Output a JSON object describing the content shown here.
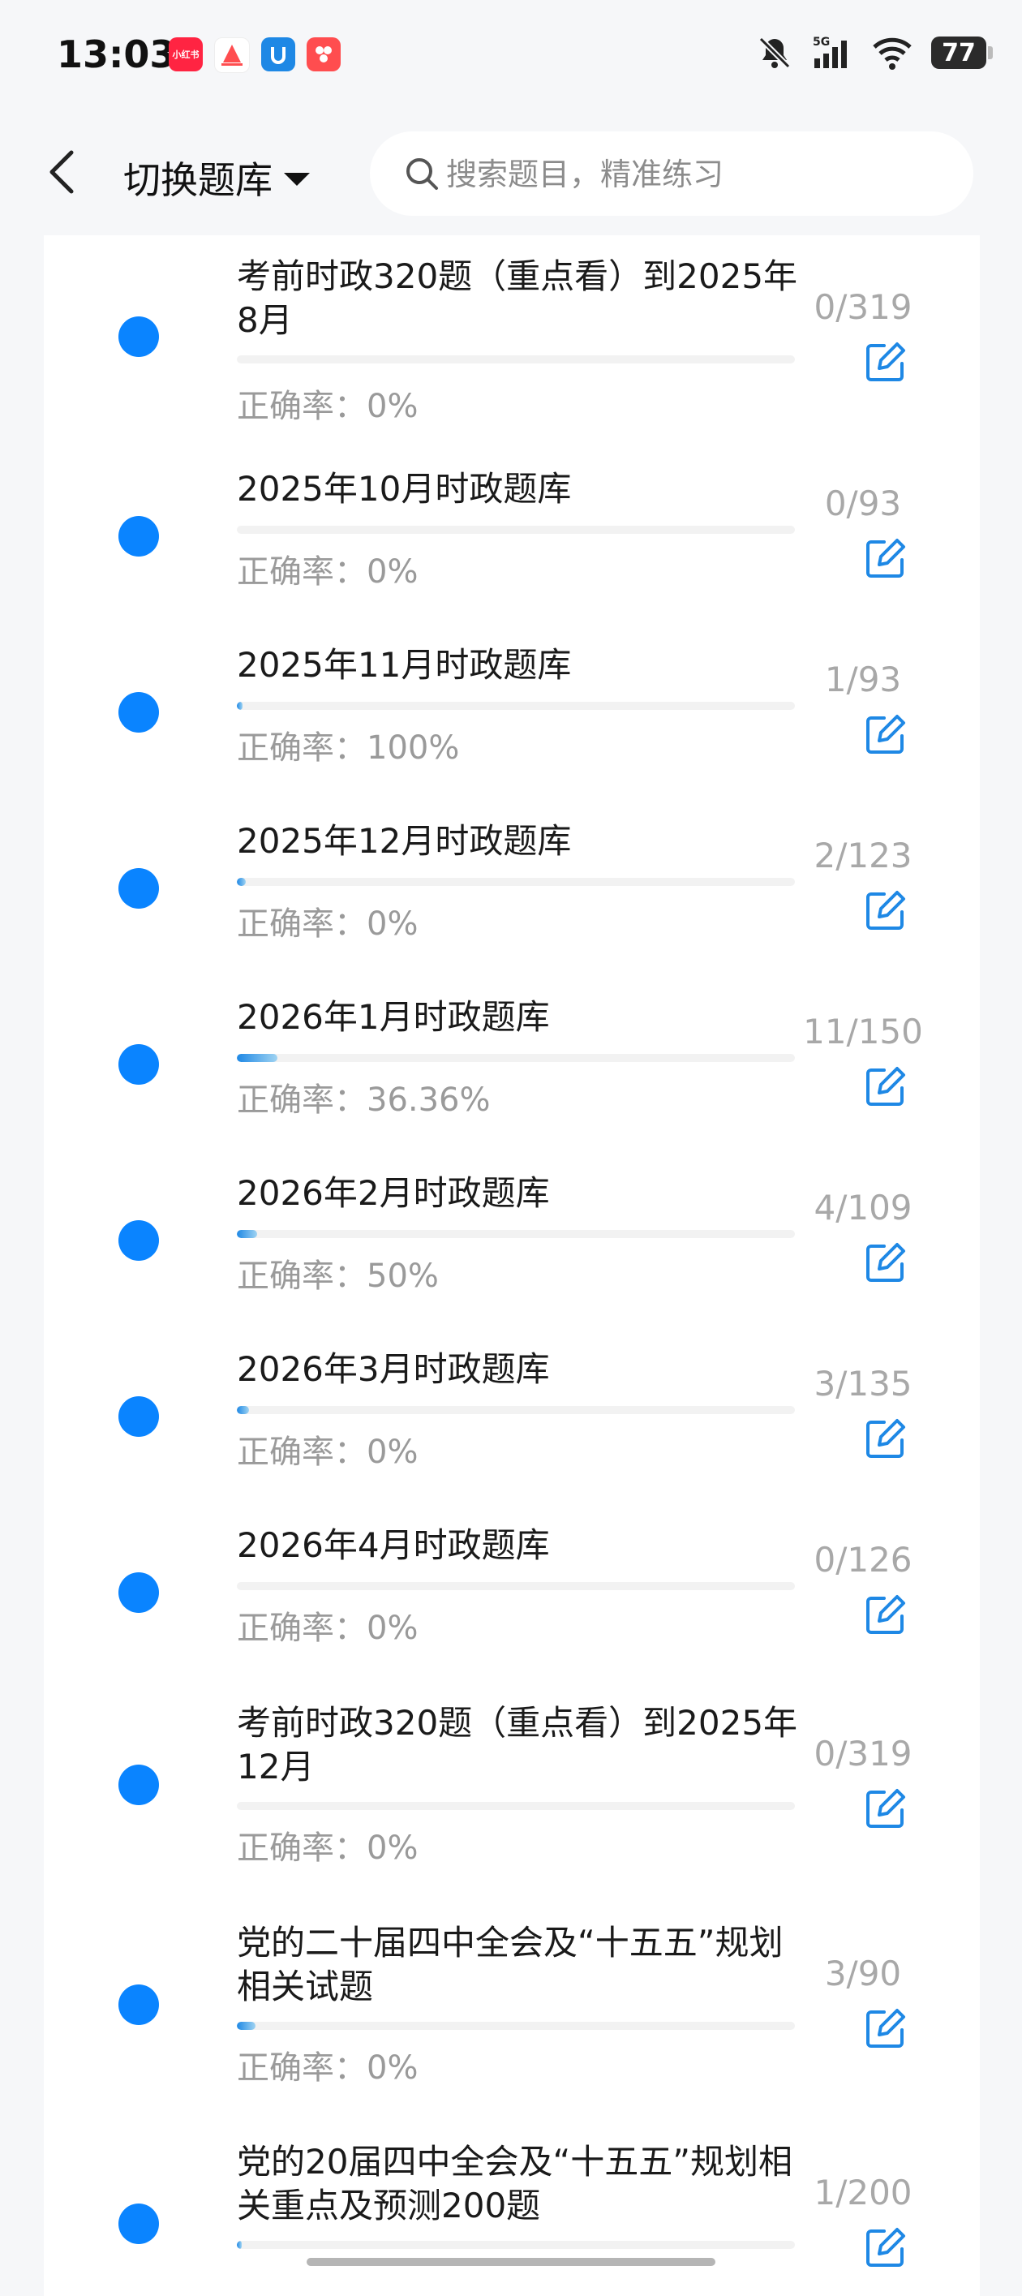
{
  "status_bar": {
    "time": "13:03",
    "battery": "77",
    "network": "5G",
    "apps": [
      {
        "name": "xiaohongshu-icon",
        "color": "#ff2442",
        "text": "小红书"
      },
      {
        "name": "app-boat-icon",
        "color": "#ff5a5a",
        "text": ""
      },
      {
        "name": "app-blue-icon",
        "color": "#1e88e5",
        "text": ""
      },
      {
        "name": "app-red-icon",
        "color": "#ff4d4f",
        "text": ""
      }
    ]
  },
  "header": {
    "switch_label": "切换题库",
    "search_placeholder": "搜索题目，精准练习"
  },
  "accent_color": "#0a84ff",
  "list": [
    {
      "title": "考前时政320题（重点看）到2025年8月",
      "count": "0/319",
      "accuracy": "正确率：0%",
      "progress": 0
    },
    {
      "title": "2025年10月时政题库",
      "count": "0/93",
      "accuracy": "正确率：0%",
      "progress": 0
    },
    {
      "title": "2025年11月时政题库",
      "count": "1/93",
      "accuracy": "正确率：100%",
      "progress": 0.0108
    },
    {
      "title": "2025年12月时政题库",
      "count": "2/123",
      "accuracy": "正确率：0%",
      "progress": 0.0163
    },
    {
      "title": "2026年1月时政题库",
      "count": "11/150",
      "accuracy": "正确率：36.36%",
      "progress": 0.0733
    },
    {
      "title": "2026年2月时政题库",
      "count": "4/109",
      "accuracy": "正确率：50%",
      "progress": 0.0367
    },
    {
      "title": "2026年3月时政题库",
      "count": "3/135",
      "accuracy": "正确率：0%",
      "progress": 0.0222
    },
    {
      "title": "2026年4月时政题库",
      "count": "0/126",
      "accuracy": "正确率：0%",
      "progress": 0
    },
    {
      "title": "考前时政320题（重点看）到2025年12月",
      "count": "0/319",
      "accuracy": "正确率：0%",
      "progress": 0
    },
    {
      "title": "党的二十届四中全会及“十五五”规划相关试题",
      "count": "3/90",
      "accuracy": "正确率：0%",
      "progress": 0.0333
    },
    {
      "title": "党的20届四中全会及“十五五”规划相关重点及预测200题",
      "count": "1/200",
      "accuracy": "",
      "progress": 0.005
    }
  ]
}
